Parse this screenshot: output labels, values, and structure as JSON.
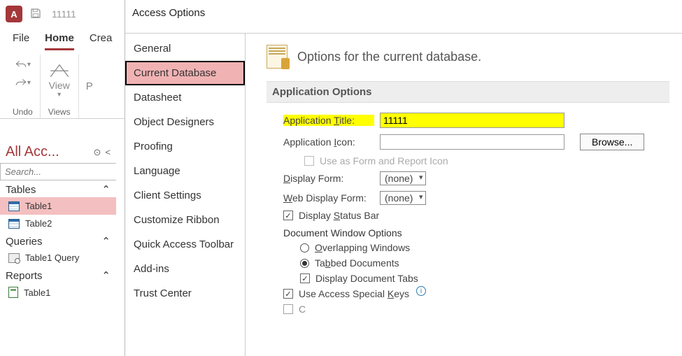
{
  "titlebar": {
    "app_letter": "A",
    "doc_title": "11111"
  },
  "ribbon_tabs": {
    "file": "File",
    "home": "Home",
    "create": "Crea"
  },
  "ribbon": {
    "undo_label": "Undo",
    "views_label": "Views",
    "view_btn": "View",
    "cut_p": "P"
  },
  "nav": {
    "title": "All Acc...",
    "search_placeholder": "Search...",
    "tables_hdr": "Tables",
    "tables": [
      "Table1",
      "Table2"
    ],
    "queries_hdr": "Queries",
    "queries": [
      "Table1 Query"
    ],
    "reports_hdr": "Reports",
    "reports": [
      "Table1"
    ]
  },
  "dialog": {
    "title": "Access Options",
    "left": {
      "general": "General",
      "current_db": "Current Database",
      "datasheet": "Datasheet",
      "obj_designers": "Object Designers",
      "proofing": "Proofing",
      "language": "Language",
      "client": "Client Settings",
      "ribbon": "Customize Ribbon",
      "qat": "Quick Access Toolbar",
      "addins": "Add-ins",
      "trust": "Trust Center"
    },
    "right": {
      "header": "Options for the current database.",
      "section": "Application Options",
      "app_title_lbl_pre": "Application ",
      "app_title_lbl_u": "T",
      "app_title_lbl_post": "itle:",
      "app_title_val": "11111",
      "app_icon_lbl_pre": "Application ",
      "app_icon_lbl_u": "I",
      "app_icon_lbl_post": "con:",
      "app_icon_val": "",
      "browse": "Browse...",
      "use_as_form": "Use as Form and Report Icon",
      "display_form_lbl_u": "D",
      "display_form_lbl_post": "isplay Form:",
      "display_form_val": "(none)",
      "web_display_lbl_u": "W",
      "web_display_lbl_post": "eb Display Form:",
      "web_display_val": "(none)",
      "status_bar_pre": "Display ",
      "status_bar_u": "S",
      "status_bar_post": "tatus Bar",
      "doc_window": "Document Window Options",
      "overlap_u": "O",
      "overlap_post": "verlapping Windows",
      "tabbed_pre": "Ta",
      "tabbed_u": "b",
      "tabbed_post": "bed Documents",
      "disp_tabs": "Display Document Tabs",
      "special_keys_pre": "Use Access Special ",
      "special_keys_u": "K",
      "special_keys_post": "eys",
      "compact_cut": "C"
    }
  }
}
